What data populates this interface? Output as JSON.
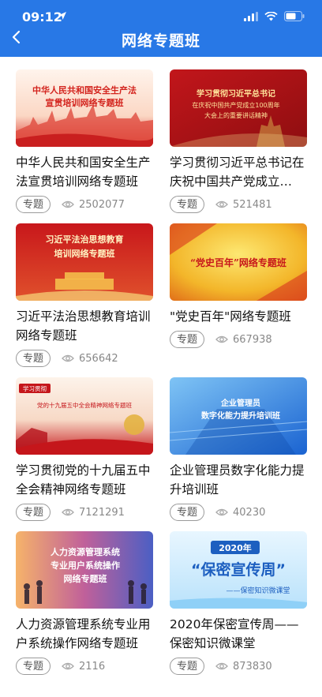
{
  "status_bar": {
    "time": "09:12"
  },
  "header": {
    "title": "网络专题班"
  },
  "colors": {
    "header_bg": "#2878e6"
  },
  "items": [
    {
      "title": "中华人民共和国安全生产法宣贯培训网络专题班",
      "tag": "专题",
      "views": "2502077",
      "thumb_text": [
        "中华人民共和国安全生产法",
        "宣贯培训网络专题班"
      ]
    },
    {
      "title": "学习贯彻习近平总书记在庆祝中国共产党成立100...",
      "tag": "专题",
      "views": "521481",
      "thumb_text": [
        "学习贯彻习近平总书记",
        "在庆祝中国共产党成立100周年",
        "大会上的重要讲话精神"
      ]
    },
    {
      "title": "习近平法治思想教育培训网络专题班",
      "tag": "专题",
      "views": "656642",
      "thumb_text": [
        "习近平法治思想教育",
        "培训网络专题班"
      ]
    },
    {
      "title": "\"党史百年\"网络专题班",
      "tag": "专题",
      "views": "667938",
      "thumb_text": [
        "“党史百年”网络专题班"
      ]
    },
    {
      "title": "学习贯彻党的十九届五中全会精神网络专题班",
      "tag": "专题",
      "views": "7121291",
      "thumb_text": [
        "学习贯彻",
        "党的十九届五中全会精神网络专题班"
      ]
    },
    {
      "title": "企业管理员数字化能力提升培训班",
      "tag": "专题",
      "views": "40230",
      "thumb_text": [
        "企业管理员",
        "数字化能力提升培训班"
      ]
    },
    {
      "title": "人力资源管理系统专业用户系统操作网络专题班",
      "tag": "专题",
      "views": "2116",
      "thumb_text": [
        "人力资源管理系统",
        "专业用户系统操作",
        "网络专题班"
      ]
    },
    {
      "title": "2020年保密宣传周——保密知识微课堂",
      "tag": "专题",
      "views": "873830",
      "thumb_text": [
        "2020年",
        "“保密宣传周”",
        "——保密知识微课堂"
      ]
    }
  ]
}
